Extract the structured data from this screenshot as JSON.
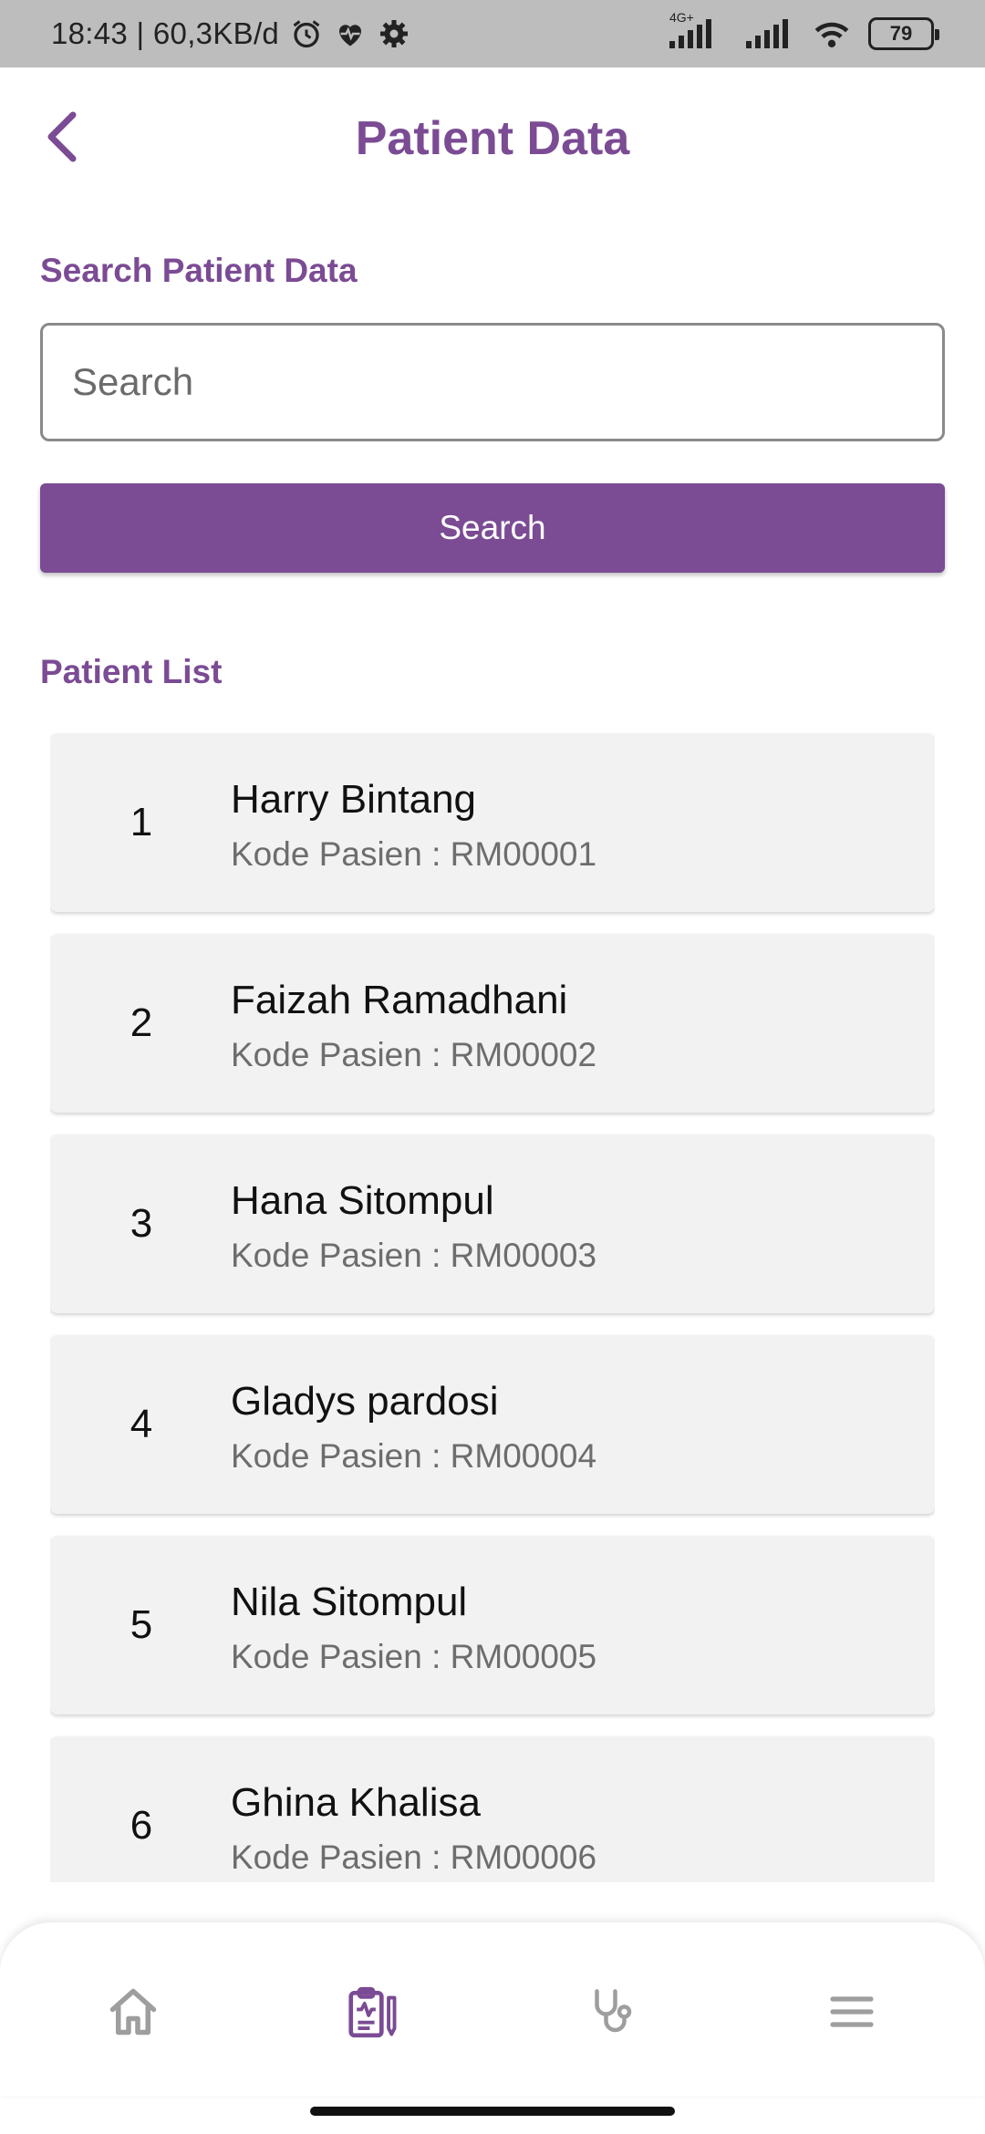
{
  "status_bar": {
    "time_info": "18:43 | 60,3KB/d",
    "network_label": "4G+",
    "battery_level": "79",
    "icons": [
      "alarm-icon",
      "heart-rate-icon",
      "settings-icon",
      "signal-icon",
      "wifi-icon",
      "battery-icon"
    ]
  },
  "header": {
    "title": "Patient Data",
    "back_icon": "chevron-left-icon"
  },
  "search": {
    "label": "Search Patient Data",
    "placeholder": "Search",
    "value": "",
    "button_label": "Search"
  },
  "list": {
    "label": "Patient List",
    "patients": [
      {
        "number": "1",
        "name": "Harry Bintang",
        "code": "Kode Pasien : RM00001"
      },
      {
        "number": "2",
        "name": "Faizah Ramadhani",
        "code": "Kode Pasien : RM00002"
      },
      {
        "number": "3",
        "name": "Hana Sitompul",
        "code": "Kode Pasien : RM00003"
      },
      {
        "number": "4",
        "name": "Gladys pardosi",
        "code": "Kode Pasien : RM00004"
      },
      {
        "number": "5",
        "name": "Nila Sitompul",
        "code": "Kode Pasien : RM00005"
      },
      {
        "number": "6",
        "name": "Ghina Khalisa",
        "code": "Kode Pasien : RM00006"
      }
    ]
  },
  "bottom_nav": {
    "items": [
      {
        "icon": "home-icon",
        "active": false
      },
      {
        "icon": "clipboard-icon",
        "active": true
      },
      {
        "icon": "stethoscope-icon",
        "active": false
      },
      {
        "icon": "menu-icon",
        "active": false
      }
    ]
  },
  "colors": {
    "accent": "#7b4b94",
    "status_bar_bg": "#bdbdbd",
    "card_bg": "#f2f2f2",
    "nav_inactive": "#9e9e9e"
  }
}
